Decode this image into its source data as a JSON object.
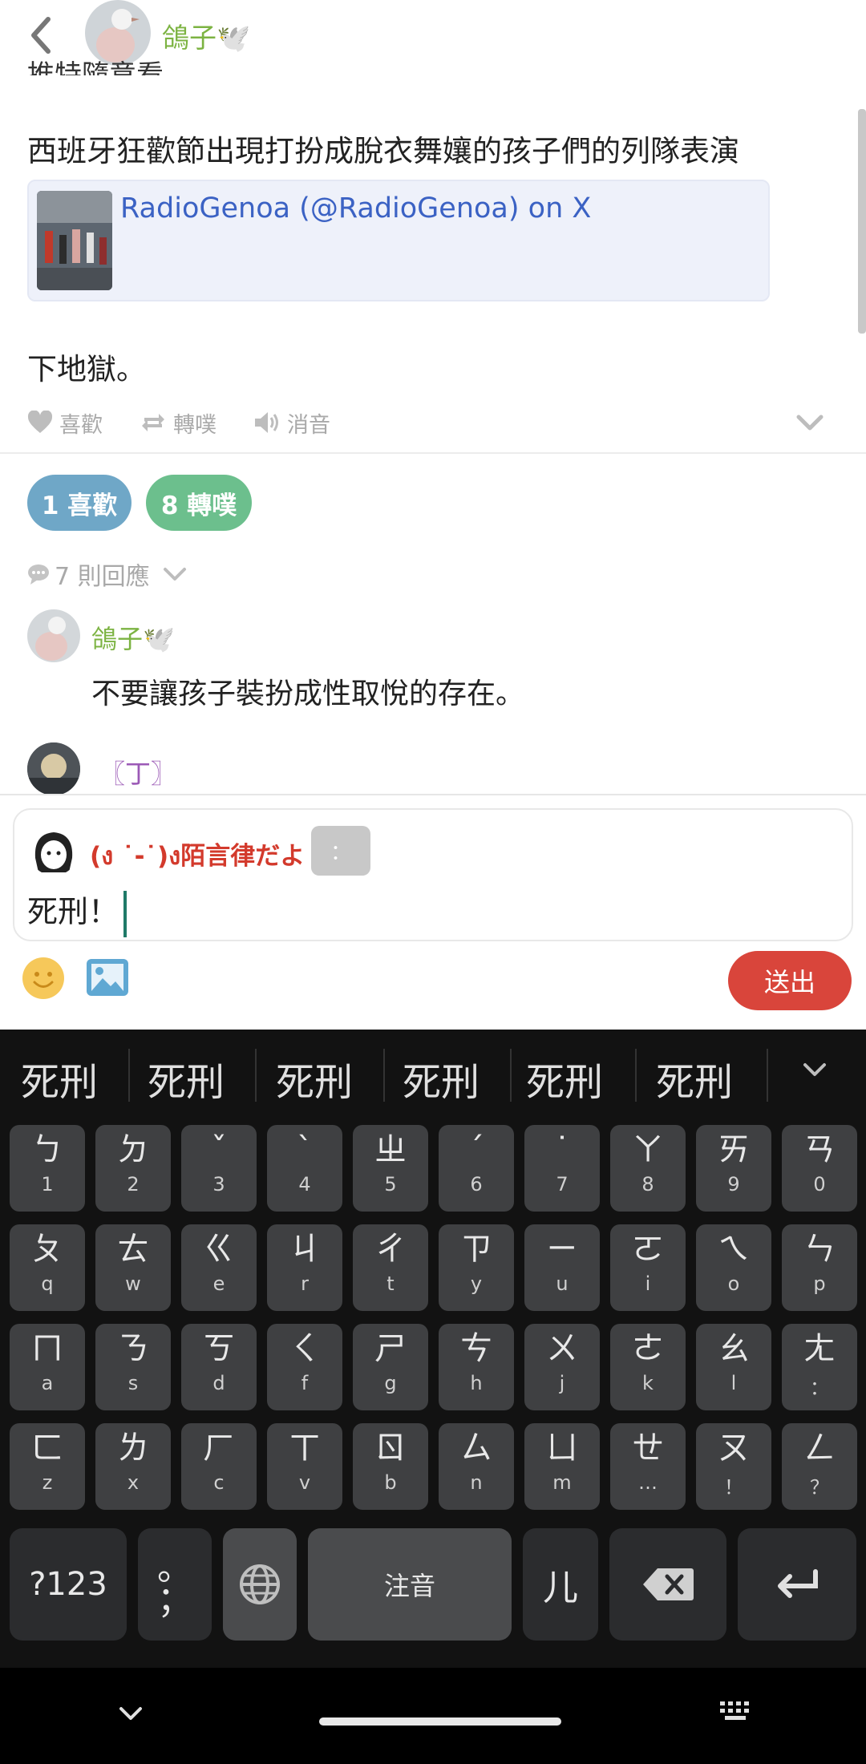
{
  "header": {
    "user_name": "鴿子🕊️"
  },
  "post": {
    "clipped_line": "推特隨意看",
    "text": "西班牙狂歡節出現打扮成脫衣舞孃的孩子們的列隊表演",
    "link_title": "RadioGenoa (@RadioGenoa) on X",
    "text2": "下地獄。"
  },
  "actions": {
    "like": "喜歡",
    "replurk": "轉噗",
    "mute": "消音"
  },
  "stats": {
    "likes": "1 喜歡",
    "replurks": "8 轉噗"
  },
  "replies": {
    "count_label": "7 則回應",
    "items": [
      {
        "name": "鴿子🕊️",
        "text": "不要讓孩子裝扮成性取悅的存在。"
      },
      {
        "name": "〖丁〗",
        "text": ""
      }
    ]
  },
  "compose": {
    "user_name": "(ง ˙-˙)ง陌言律だよ",
    "qualifier": "：",
    "input_value": "死刑！",
    "send_label": "送出"
  },
  "keyboard": {
    "suggestions": [
      "死刑",
      "死刑",
      "死刑",
      "死刑",
      "死刑",
      "死刑"
    ],
    "rows": [
      [
        [
          "ㄅ",
          "1"
        ],
        [
          "ㄉ",
          "2"
        ],
        [
          "ˇ",
          "3"
        ],
        [
          "ˋ",
          "4"
        ],
        [
          "ㄓ",
          "5"
        ],
        [
          "ˊ",
          "6"
        ],
        [
          "˙",
          "7"
        ],
        [
          "ㄚ",
          "8"
        ],
        [
          "ㄞ",
          "9"
        ],
        [
          "ㄢ",
          "0"
        ]
      ],
      [
        [
          "ㄆ",
          "q"
        ],
        [
          "ㄊ",
          "w"
        ],
        [
          "ㄍ",
          "e"
        ],
        [
          "ㄐ",
          "r"
        ],
        [
          "ㄔ",
          "t"
        ],
        [
          "ㄗ",
          "y"
        ],
        [
          "ㄧ",
          "u"
        ],
        [
          "ㄛ",
          "i"
        ],
        [
          "ㄟ",
          "o"
        ],
        [
          "ㄣ",
          "p"
        ]
      ],
      [
        [
          "ㄇ",
          "a"
        ],
        [
          "ㄋ",
          "s"
        ],
        [
          "ㄎ",
          "d"
        ],
        [
          "ㄑ",
          "f"
        ],
        [
          "ㄕ",
          "g"
        ],
        [
          "ㄘ",
          "h"
        ],
        [
          "ㄨ",
          "j"
        ],
        [
          "ㄜ",
          "k"
        ],
        [
          "ㄠ",
          "l"
        ],
        [
          "ㄤ",
          "："
        ]
      ],
      [
        [
          "ㄈ",
          "z"
        ],
        [
          "ㄌ",
          "x"
        ],
        [
          "ㄏ",
          "c"
        ],
        [
          "ㄒ",
          "v"
        ],
        [
          "ㄖ",
          "b"
        ],
        [
          "ㄙ",
          "n"
        ],
        [
          "ㄩ",
          "m"
        ],
        [
          "ㄝ",
          "…"
        ],
        [
          "ㄡ",
          "！"
        ],
        [
          "ㄥ",
          "？"
        ]
      ]
    ],
    "symbols_label": "?123",
    "punct_top": "。",
    "punct_bottom": "；",
    "space_label": "注音",
    "er_label": "儿"
  },
  "colors": {
    "accent_green": "#7cb342",
    "send_red": "#d9453b",
    "link_blue": "#3b62c4"
  }
}
